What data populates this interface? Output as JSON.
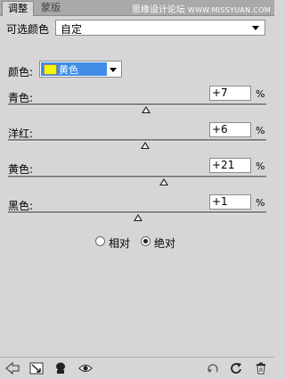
{
  "tabs": [
    {
      "label": "调整",
      "active": true
    },
    {
      "label": "蒙版",
      "active": false
    }
  ],
  "watermark": {
    "text": "思缘设计论坛",
    "site": "WWW.MISSYUAN.COM"
  },
  "header": {
    "title": "可选颜色",
    "preset_value": "自定"
  },
  "colors": {
    "label": "颜色:",
    "selected": "黄色",
    "swatch_color": "#f5f500"
  },
  "sliders": [
    {
      "label": "青色:",
      "value": "+7",
      "unit": "%",
      "level": 7
    },
    {
      "label": "洋红:",
      "value": "+6",
      "unit": "%",
      "level": 6
    },
    {
      "label": "黄色:",
      "value": "+21",
      "unit": "%",
      "level": 21
    },
    {
      "label": "黑色:",
      "value": "+1",
      "unit": "%",
      "level": 1
    }
  ],
  "method": {
    "options": [
      {
        "label": "相对",
        "checked": false
      },
      {
        "label": "绝对",
        "checked": true
      }
    ]
  },
  "toolbar": {
    "left_icons": [
      "back-arrow-icon",
      "clip-to-layer-icon",
      "layer-mask-icon",
      "eye-icon"
    ],
    "right_icons": [
      "previous-state-icon",
      "reset-icon",
      "trash-icon"
    ]
  }
}
